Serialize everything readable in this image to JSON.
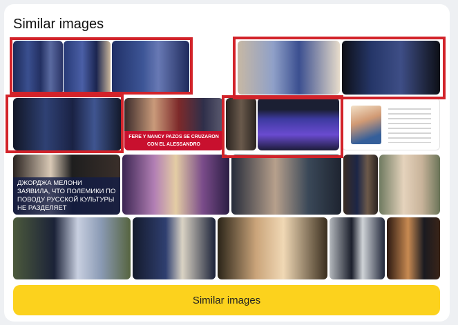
{
  "section": {
    "title": "Similar images"
  },
  "thumbnails": [
    {
      "name": "thumb-1-1",
      "bg": "linear-gradient(90deg,#1d2a58 0%,#3a4f8f 30%,#233062 55%,#5a6aa0 75%,#2a3466 100%)"
    },
    {
      "name": "thumb-1-2",
      "bg": "linear-gradient(90deg,#273975 0%,#4a5fa6 40%,#1b2550 70%,#c9b59a 100%)"
    },
    {
      "name": "thumb-1-3",
      "bg": "linear-gradient(90deg,#203066 0%,#3d5596 40%,#6879b4 60%,#1e2a5c 100%)"
    },
    {
      "name": "thumb-1-4",
      "bg": "linear-gradient(90deg,#c7b8a4 0%,#8fa0c8 35%,#3b4f90 60%,#e7dccb 100%)"
    },
    {
      "name": "thumb-1-5",
      "bg": "linear-gradient(90deg,#0d0f16 0%,#253668 30%,#3e4e86 60%,#0d0f16 100%)"
    },
    {
      "name": "thumb-2-1",
      "bg": "linear-gradient(90deg,#111626 0%,#2f4174 30%,#1a2244 55%,#3f5590 75%,#121829 100%)"
    },
    {
      "name": "thumb-2-2",
      "bg": "linear-gradient(90deg,#3a2a2a 0%,#c99a7a 30%,#7d2a2a 55%,#2f2f4a 80%,#5b5b70 100%)",
      "caption": "FERE Y NANCY PAZOS SE CRUZARON CON EL ALESSANDRO",
      "caption_style": "red"
    },
    {
      "name": "thumb-2-3",
      "bg": "linear-gradient(90deg,#2a2420 0%,#6a5a4c 50%,#2a2420 100%)"
    },
    {
      "name": "thumb-2-4",
      "bg": "linear-gradient(180deg,#1b1f33 0%,#1b1f33 22%,#3d3aa0 40%,#6a4bd0 70%,#1c1c3a 100%)"
    },
    {
      "name": "thumb-2-5",
      "bg": "linear-gradient(90deg,#ffffff 0%,#ffffff 100%)",
      "doc": true
    },
    {
      "name": "thumb-3-1",
      "bg": "linear-gradient(90deg,#2a2320 0%,#d9c9b6 35%,#1e1e1e 55%,#3a2f2a 100%)",
      "caption": "ДЖОРДЖА МЕЛОНИ ЗАЯВИЛА, ЧТО ПОЛЕМИКИ ПО ПОВОДУ РУССКОЙ КУЛЬТУРЫ НЕ РАЗДЕЛЯЕТ",
      "caption_style": "blue"
    },
    {
      "name": "thumb-3-2",
      "bg": "linear-gradient(90deg,#3b2552 0%,#b27fb4 30%,#e4cda4 50%,#7a4c8a 75%,#2c1d44 100%)",
      "caption": "",
      "caption_style": "small"
    },
    {
      "name": "thumb-3-3",
      "bg": "linear-gradient(90deg,#262c3a 0%,#b7a08c 40%,#3a4858 70%,#1e2430 100%)"
    },
    {
      "name": "thumb-3-4",
      "bg": "linear-gradient(90deg,#3a2c22 0%,#1c2647 40%,#6d5a4a 70%,#2a2320 100%)"
    },
    {
      "name": "thumb-3-5",
      "bg": "linear-gradient(90deg,#6f7a60 0%,#e5d3bc 40%,#c8b39a 70%,#6a7458 100%)"
    },
    {
      "name": "thumb-4-1",
      "bg": "linear-gradient(90deg,#4c5a3c 0%,#1b2238 35%,#c8cfe0 55%,#8a9ab4 75%,#56643f 100%)"
    },
    {
      "name": "thumb-4-2",
      "bg": "linear-gradient(90deg,#141a2c 0%,#2f3f70 40%,#dad3c4 60%,#1a2138 100%)",
      "caption": "",
      "caption_style": "white"
    },
    {
      "name": "thumb-4-3",
      "bg": "linear-gradient(90deg,#2a2418 0%,#caa47a 35%,#f0d8b5 60%,#3a2e1e 100%)"
    },
    {
      "name": "thumb-4-4",
      "bg": "linear-gradient(90deg,#b4b8bd 0%,#1b1f2c 40%,#cfd3d7 60%,#21273a 100%)"
    },
    {
      "name": "thumb-4-5",
      "bg": "linear-gradient(90deg,#2b1810 0%,#c88a52 40%,#1a1a20 70%,#3a2418 100%)"
    }
  ],
  "button": {
    "label": "Similar images"
  },
  "colors": {
    "highlight": "#d2232a",
    "button": "#fcd21d"
  }
}
